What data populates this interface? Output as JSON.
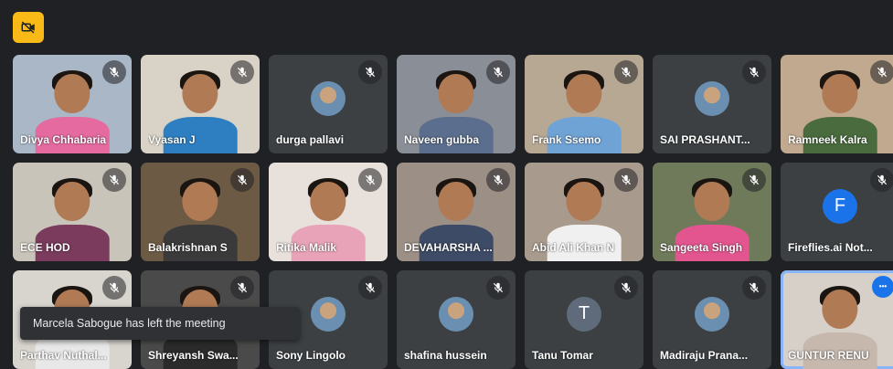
{
  "top_badge": {
    "icon": "camera-off-icon",
    "color": "#f9ba17"
  },
  "notification": {
    "text": "Marcela Sabogue has left the meeting"
  },
  "participants": [
    {
      "name": "Divya Chhabaria",
      "kind": "video",
      "shirt": "#e46aa0",
      "bg": "#a9b7c6"
    },
    {
      "name": "Vyasan J",
      "kind": "video",
      "shirt": "#2e7fc2",
      "bg": "#d9d3c7"
    },
    {
      "name": "durga pallavi",
      "kind": "photo"
    },
    {
      "name": "Naveen gubba",
      "kind": "video",
      "shirt": "#5b6e8e",
      "bg": "#8a8e96"
    },
    {
      "name": "Frank Ssemo",
      "kind": "video",
      "shirt": "#6fa3d6",
      "bg": "#b7a894"
    },
    {
      "name": "SAI PRASHANT...",
      "kind": "photo"
    },
    {
      "name": "Ramneek Kalra",
      "kind": "video",
      "shirt": "#4a6b3e",
      "bg": "#c0a98e"
    },
    {
      "name": "ECE HOD",
      "kind": "video",
      "shirt": "#7a3b5c",
      "bg": "#c9c4b9"
    },
    {
      "name": "Balakrishnan S",
      "kind": "video",
      "shirt": "#3a3a3a",
      "bg": "#6d5a45"
    },
    {
      "name": "Ritika Malik",
      "kind": "video",
      "shirt": "#e9a3b8",
      "bg": "#e8e0da"
    },
    {
      "name": "DEVAHARSHA ...",
      "kind": "video",
      "shirt": "#3d4b66",
      "bg": "#9c8f86"
    },
    {
      "name": "Abid Ali Khan N",
      "kind": "video",
      "shirt": "#f0f0f0",
      "bg": "#a89a8c"
    },
    {
      "name": "Sangeeta Singh",
      "kind": "video",
      "shirt": "#e2558f",
      "bg": "#6e7a5a"
    },
    {
      "name": "Fireflies.ai Not...",
      "kind": "letter",
      "letter": "F",
      "color": "#1a73e8"
    },
    {
      "name": "Parthav Nuthal...",
      "kind": "video",
      "shirt": "#e8e8e8",
      "bg": "#d8d4ce"
    },
    {
      "name": "Shreyansh Swa...",
      "kind": "video",
      "shirt": "#2b2b2b",
      "bg": "#4a4a4a"
    },
    {
      "name": "Sony Lingolo",
      "kind": "photo"
    },
    {
      "name": "shafina hussein",
      "kind": "photo"
    },
    {
      "name": "Tanu Tomar",
      "kind": "letter",
      "letter": "T",
      "color": "#5f6b7a"
    },
    {
      "name": "Madiraju Prana...",
      "kind": "photo"
    },
    {
      "name": "GUNTUR RENU",
      "kind": "video",
      "shirt": "#c7b8ad",
      "bg": "#d6d0c8",
      "active": true
    }
  ]
}
